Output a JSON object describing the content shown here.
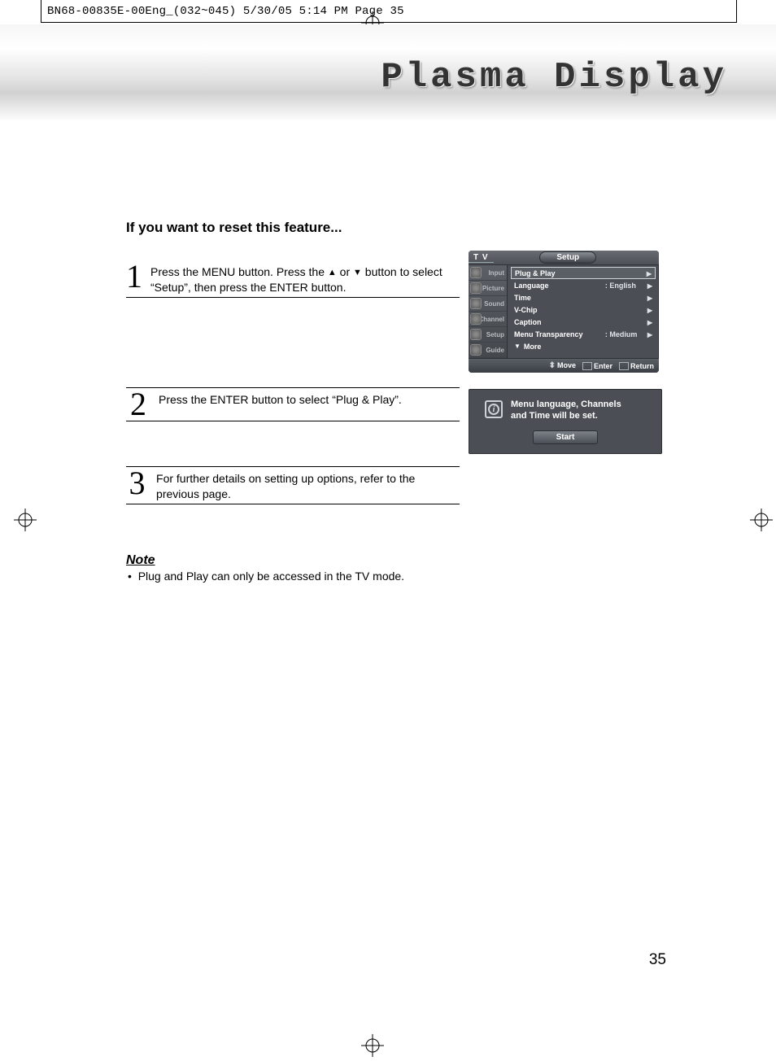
{
  "print_meta": "BN68-00835E-00Eng_(032~045)  5/30/05  5:14 PM  Page 35",
  "header_title": "Plasma Display",
  "section_heading": "If you want to reset this feature...",
  "steps": [
    {
      "num": "1",
      "text_a": "Press the MENU button. Press the ",
      "text_b": " or ",
      "text_c": " button to select “Setup”, then press the ENTER button."
    },
    {
      "num": "2",
      "text": "Press the ENTER button to select “Plug & Play”."
    },
    {
      "num": "3",
      "text": "For further details on setting up options, refer to the previous page."
    }
  ],
  "note_heading": "Note",
  "note_bullet": "Plug and Play can only be accessed in the TV mode.",
  "page_number": "35",
  "osd1": {
    "tv": "T V",
    "title": "Setup",
    "side": [
      "Input",
      "Picture",
      "Sound",
      "Channel",
      "Setup",
      "Guide"
    ],
    "rows": [
      {
        "k": "Plug & Play",
        "v": "",
        "sel": true
      },
      {
        "k": "Language",
        "v": ": English"
      },
      {
        "k": "Time",
        "v": ""
      },
      {
        "k": "V-Chip",
        "v": ""
      },
      {
        "k": "Caption",
        "v": ""
      },
      {
        "k": "Menu Transparency",
        "v": ": Medium"
      }
    ],
    "more": "More",
    "foot_move": "Move",
    "foot_enter": "Enter",
    "foot_return": "Return"
  },
  "osd2": {
    "text_l1": "Menu language, Channels",
    "text_l2": "and Time will be set.",
    "start": "Start"
  }
}
